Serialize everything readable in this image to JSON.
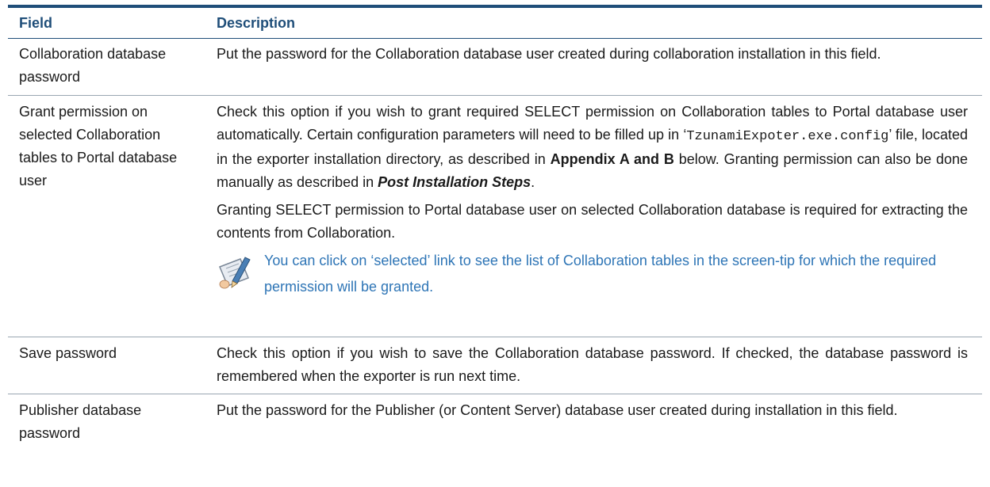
{
  "header": {
    "field": "Field",
    "description": "Description"
  },
  "rows": [
    {
      "field": "Collaboration database password",
      "description": "Put the password for the Collaboration database user created during collaboration installation in this field."
    },
    {
      "field": "Grant permission on selected Collaboration tables to Portal database user",
      "desc_part1": "Check this option if you wish to grant required SELECT permission on Collaboration tables to Portal database user automatically. Certain configuration parameters will need to be filled up in ",
      "desc_quote_open": "‘",
      "desc_code": "TzunamiExpoter.exe.config",
      "desc_quote_close": "’",
      "desc_part2": " file, located in the exporter installation directory, as described in ",
      "desc_bold": "Appendix A and B",
      "desc_part3": " below. Granting permission can also be done manually as described in ",
      "desc_bold_italic": "Post Installation Steps",
      "desc_part4": ".",
      "para2": "Granting SELECT permission to Portal database user on selected Collaboration database is required for extracting the contents from Collaboration.",
      "note": "You can click on ‘selected’ link to see the list of Collaboration tables in the screen-tip for which the required permission will be granted."
    },
    {
      "field": "Save password",
      "description": "Check this option if you wish to save the Collaboration database password. If checked, the database password is remembered when the exporter is run next time."
    },
    {
      "field": "Publisher database password",
      "description": "Put the password for the Publisher (or Content Server) database user created during installation in this field."
    }
  ],
  "colors": {
    "header_text": "#1f4e79",
    "top_rule": "#1f4e79",
    "note_text": "#2e75b6",
    "row_divider": "#9aa6b2"
  },
  "icons": {
    "note": "note-pencil-icon"
  }
}
